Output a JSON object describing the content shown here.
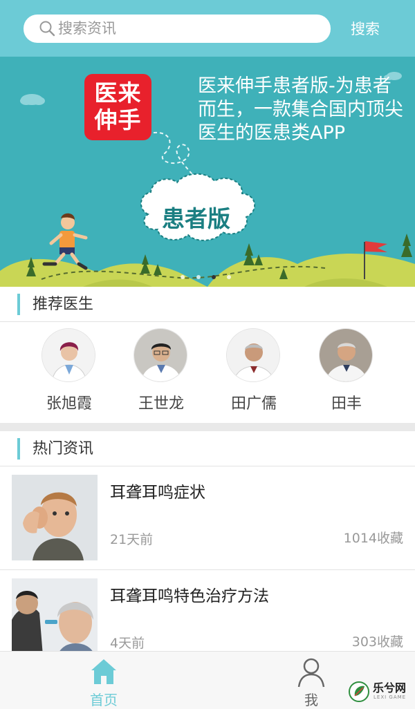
{
  "search": {
    "placeholder": "搜索资讯",
    "button_label": "搜索"
  },
  "banner": {
    "logo_text_line1": "医来",
    "logo_text_line2": "伸手",
    "headline": "医来伸手患者版-为患者而生，一款集合国内顶尖医生的医患类APP",
    "cloud_label": "患者版",
    "carousel_total": 4,
    "carousel_active": 3
  },
  "recommended": {
    "title": "推荐医生",
    "doctors": [
      {
        "name": "张旭霞"
      },
      {
        "name": "王世龙"
      },
      {
        "name": "田广儒"
      },
      {
        "name": "田丰"
      }
    ]
  },
  "hot_news": {
    "title": "热门资讯",
    "items": [
      {
        "title": "耳聋耳鸣症状",
        "time": "21天前",
        "favorites": "1014收藏"
      },
      {
        "title": "耳聋耳鸣特色治疗方法",
        "time": "4天前",
        "favorites": "303收藏"
      }
    ]
  },
  "tabs": [
    {
      "label": "首页",
      "icon": "home-icon",
      "active": true
    },
    {
      "label": "我",
      "icon": "user-icon",
      "active": false
    }
  ],
  "watermark": {
    "text": "乐兮网",
    "sub": "LEXI GAME"
  },
  "colors": {
    "accent": "#6ccbd6",
    "banner_bg": "#3fb1b9",
    "logo_red": "#e8212c",
    "active_tab": "#6ccbd6",
    "inactive_tab": "#666666"
  }
}
